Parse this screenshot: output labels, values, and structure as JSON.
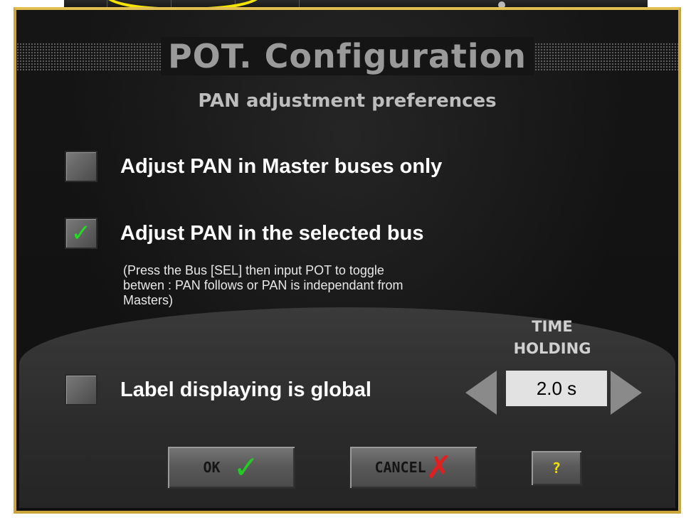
{
  "dialog": {
    "title": "POT. Configuration",
    "subtitle": "PAN adjustment preferences"
  },
  "options": {
    "master_only": {
      "label": "Adjust PAN in Master buses only",
      "checked": false
    },
    "selected_bus": {
      "label": "Adjust PAN in the selected bus",
      "checked": true
    },
    "selected_bus_note": "(Press the Bus [SEL] then input POT to toggle betwen : PAN follows or PAN is independant from Masters)",
    "label_global": {
      "label": "Label displaying is global",
      "checked": false
    }
  },
  "time_holding": {
    "label_line1": "TIME",
    "label_line2": "HOLDING",
    "value": "2.0 s"
  },
  "buttons": {
    "ok_label": "OK",
    "cancel_label": "CANCEL",
    "help_label": "?"
  },
  "icons": {
    "check": "check-icon",
    "cross": "cross-icon",
    "left": "arrow-left-icon",
    "right": "arrow-right-icon"
  },
  "colors": {
    "accent_border": "#c9a53c",
    "check_green": "#22cc22",
    "cancel_red": "#e02020",
    "help_yellow": "#f2e200",
    "highlight_ellipse": "#f4e400"
  }
}
